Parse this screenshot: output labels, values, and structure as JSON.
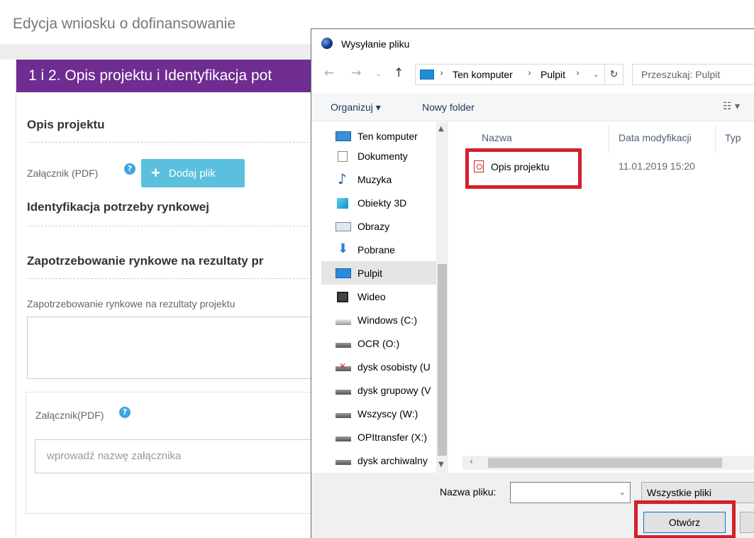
{
  "page": {
    "title": "Edycja wniosku o dofinansowanie",
    "panel_header": "1 i 2. Opis projektu i Identyfikacja pot",
    "section1": "Opis projektu",
    "attachment_label": "Załącznik (PDF)",
    "add_file_label": "Dodaj plik",
    "section2": "Identyfikacja potrzeby rynkowej",
    "section3": "Zapotrzebowanie rynkowe na rezultaty pr",
    "field_label": "Zapotrzebowanie rynkowe na rezultaty projektu",
    "attachment2_label": "Załącznik(PDF)",
    "attachment_name_placeholder": "wprowadź nazwę załącznika",
    "help_glyph": "?",
    "colors": {
      "header_bg": "#6f2c91",
      "button_bg": "#5bc0de",
      "help_icon": "#3fa4e0"
    }
  },
  "dialog": {
    "title": "Wysyłanie pliku",
    "address": {
      "computer": "Ten komputer",
      "folder": "Pulpit"
    },
    "search_placeholder": "Przeszukaj: Pulpit",
    "toolbar": {
      "organize": "Organizuj ▾",
      "new_folder": "Nowy folder"
    },
    "nav_items": [
      {
        "label": "Ten komputer",
        "icon": "computer-icon"
      },
      {
        "label": "Dokumenty",
        "icon": "documents-icon"
      },
      {
        "label": "Muzyka",
        "icon": "music-icon"
      },
      {
        "label": "Obiekty 3D",
        "icon": "objects-3d-icon"
      },
      {
        "label": "Obrazy",
        "icon": "pictures-icon"
      },
      {
        "label": "Pobrane",
        "icon": "downloads-icon"
      },
      {
        "label": "Pulpit",
        "icon": "desktop-icon",
        "selected": true
      },
      {
        "label": "Wideo",
        "icon": "video-icon"
      },
      {
        "label": "Windows (C:)",
        "icon": "windows-drive-icon"
      },
      {
        "label": "OCR (O:)",
        "icon": "network-drive-icon"
      },
      {
        "label": "dysk osobisty (U",
        "icon": "disconnected-drive-icon"
      },
      {
        "label": "dysk grupowy (V",
        "icon": "network-drive-icon"
      },
      {
        "label": "Wszyscy (W:)",
        "icon": "network-drive-icon"
      },
      {
        "label": "OPItransfer (X:)",
        "icon": "network-drive-icon"
      },
      {
        "label": "dysk archiwalny",
        "icon": "network-drive-icon"
      }
    ],
    "columns": {
      "name": "Nazwa",
      "date": "Data modyfikacji",
      "type": "Typ"
    },
    "files": [
      {
        "name": "Opis projektu",
        "date": "11.01.2019 15:20",
        "icon": "pdf-icon"
      }
    ],
    "filename_label": "Nazwa pliku:",
    "filename_value": "",
    "filter_value": "Wszystkie pliki",
    "open_label": "Otwórz",
    "colors": {
      "highlight": "#d3202a",
      "selected_nav": "#e5e5e5",
      "open_border": "#0078d7"
    }
  }
}
